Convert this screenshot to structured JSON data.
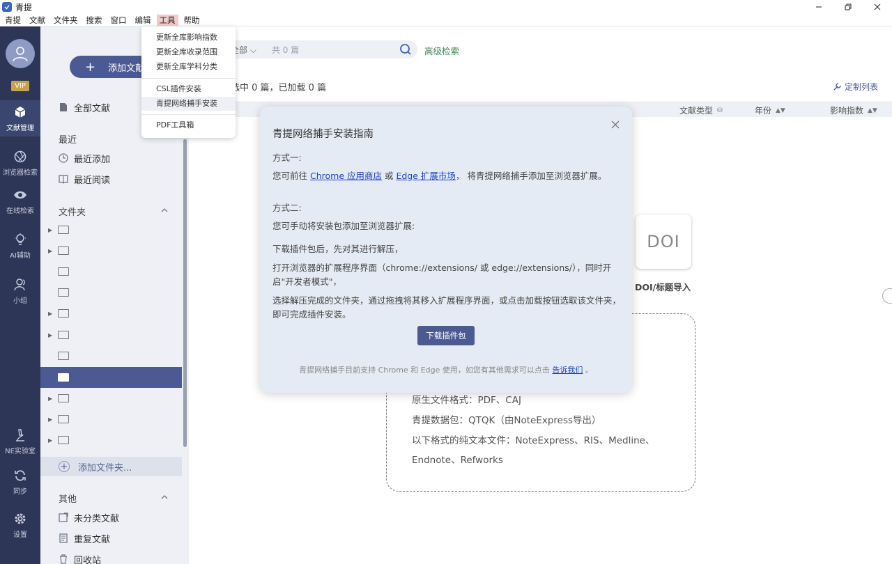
{
  "app": {
    "title": "青提"
  },
  "menubar": [
    "青提",
    "文献",
    "文件夹",
    "搜索",
    "窗口",
    "编辑",
    "工具",
    "帮助"
  ],
  "tools_menu": {
    "group1": [
      "更新全库影响指数",
      "更新全库收录范围",
      "更新全库学科分类"
    ],
    "group2": [
      "CSL插件安装",
      "青提网络捕手安装"
    ],
    "group3": [
      "PDF工具箱"
    ]
  },
  "sidebar": {
    "vip": "VIP",
    "nav": [
      "文献管理",
      "浏览器检索",
      "在线检索",
      "AI辅助",
      "小组"
    ],
    "bottom": [
      "NE实验室",
      "同步",
      "设置"
    ]
  },
  "folder_panel": {
    "add_button": "添加文献",
    "all_docs": "全部文献",
    "recent_title": "最近",
    "recent_items": [
      "最近添加",
      "最近阅读"
    ],
    "folders_title": "文件夹",
    "add_folder": "添加文件夹...",
    "other_title": "其他",
    "other_items": [
      "未分类文献",
      "重复文献",
      "回收站"
    ]
  },
  "main": {
    "search_scope": "全部",
    "search_count": "共 0 篇",
    "advanced_search": "高级检索",
    "selection_summary": "选中 0 篇，已加载 0 篇",
    "custom_list": "定制列表",
    "columns": [
      "文献类型",
      "年份",
      "影响指数"
    ],
    "doi_card": "DOI",
    "doi_label": "DOI/标题导入",
    "dropzone_lines": [
      "原生文件格式：PDF、CAJ",
      "青提数据包：QTQK（由NoteExpress导出）",
      "以下格式的纯文本文件：NoteExpress、RIS、Medline、",
      "Endnote、Refworks"
    ]
  },
  "modal": {
    "title": "青提网络捕手安装指南",
    "method1_title": "方式一:",
    "method1_prefix": "您可前往 ",
    "chrome_link": "Chrome 应用商店",
    "or": " 或 ",
    "edge_link": "Edge 扩展市场",
    "method1_suffix": "， 将青提网络捕手添加至浏览器扩展。",
    "method2_title": "方式二:",
    "method2_intro": "您可手动将安装包添加至浏览器扩展:",
    "step1": "下载插件包后，先对其进行解压，",
    "step2": "打开浏览器的扩展程序界面（chrome://extensions/ 或 edge://extensions/），同时开启\"开发者模式\"，",
    "step3": "选择解压完成的文件夹，通过拖拽将其移入扩展程序界面，或点击加载按钮选取该文件夹，即可完成插件安装。",
    "download_button": "下载插件包",
    "footer_text": "青提网络捕手目前支持 Chrome 和 Edge 使用，如您有其他需求可以点击 ",
    "footer_link": "告诉我们",
    "footer_end": " 。"
  }
}
